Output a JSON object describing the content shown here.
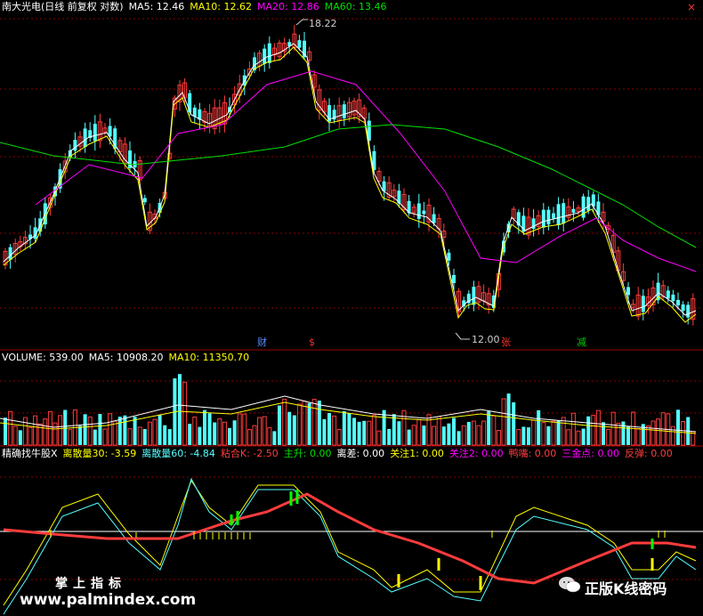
{
  "top_legend": {
    "title": "南大光电(日线 前复权 对数)",
    "ma5": "MA5: 12.46",
    "ma10": "MA10: 12.62",
    "ma20": "MA20: 12.86",
    "ma60": "MA60: 13.46"
  },
  "volume_legend": {
    "title": "VOLUME: 539.00",
    "ma5": "MA5: 10908.20",
    "ma10": "MA10: 11350.70"
  },
  "indicator_legend": {
    "name": "精确找牛股X",
    "v1": "离散量30: -3.59",
    "v2": "离散量60: -4.84",
    "v3": "粘合K: -2.50",
    "v4": "主升: 0.00",
    "v5": "离差: 0.00",
    "v6": "关注1: 0.00",
    "v7": "关注2: 0.00",
    "v8": "鸭嘴: 0.00",
    "v9": "三金点: 0.00",
    "v10": "反弹: 0.00"
  },
  "close_symbol": "×",
  "annotations": {
    "high_label": "18.22",
    "low_label": "12.00",
    "event_cai": "财",
    "event_dollar": "$",
    "event_zhang": "张",
    "event_jian": "减"
  },
  "watermark": {
    "line1": "掌上指标",
    "line2": "www.palmindex.com",
    "wechat_text": "正版K线密码"
  },
  "colors": {
    "up": "#ff3c3c",
    "down": "#54ffff",
    "ma5": "#ffffff",
    "ma10": "#ffff00",
    "ma20": "#ff00ff",
    "ma60": "#00e000",
    "background": "#000000",
    "grid": "#8b0000"
  },
  "chart_data": [
    {
      "type": "candlestick",
      "title": "南大光电(日线 前复权 对数)",
      "axis": "log",
      "high_marker": 18.22,
      "low_marker": 12.0,
      "series": [
        {
          "name": "MA5",
          "last": 12.46
        },
        {
          "name": "MA10",
          "last": 12.62
        },
        {
          "name": "MA20",
          "last": 12.86
        },
        {
          "name": "MA60",
          "last": 13.46
        }
      ]
    },
    {
      "type": "bar",
      "title": "VOLUME",
      "last": 539.0,
      "series": [
        {
          "name": "MA5",
          "last": 10908.2
        },
        {
          "name": "MA10",
          "last": 11350.7
        }
      ]
    },
    {
      "type": "line",
      "title": "精确找牛股X",
      "series": [
        {
          "name": "离散量30",
          "last": -3.59
        },
        {
          "name": "离散量60",
          "last": -4.84
        },
        {
          "name": "粘合K",
          "last": -2.5
        }
      ]
    }
  ]
}
